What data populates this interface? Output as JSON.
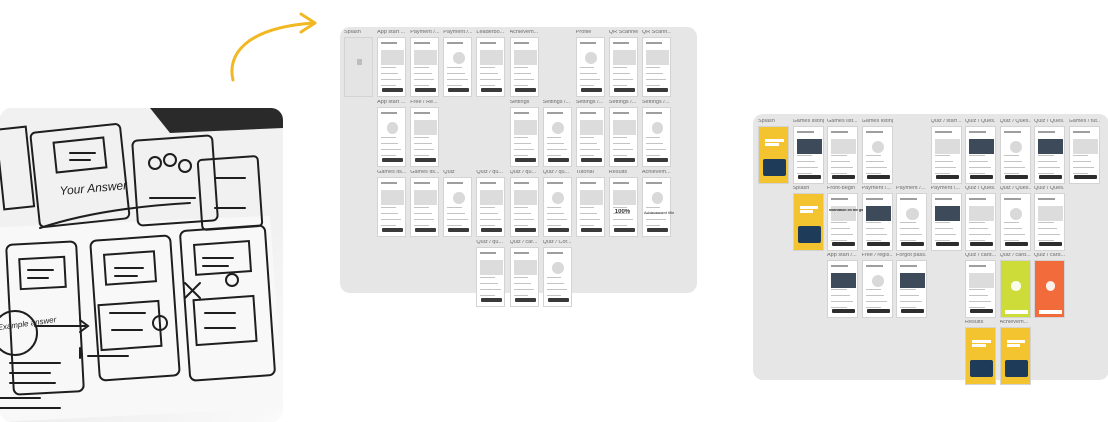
{
  "arrow": {
    "color": "#f2b824",
    "icon": "curved-arrow-icon"
  },
  "sketch": {
    "texts": [
      "Your Answer",
      "Example answer"
    ]
  },
  "wireframes": {
    "frames": [
      {
        "label": "Splash",
        "col": 0,
        "row": 0
      },
      {
        "label": "App start ...",
        "col": 1,
        "row": 0
      },
      {
        "label": "Payment /...",
        "col": 2,
        "row": 0
      },
      {
        "label": "Payment /...",
        "col": 3,
        "row": 0
      },
      {
        "label": "Leaderbo...",
        "col": 4,
        "row": 0
      },
      {
        "label": "Achievem...",
        "col": 5,
        "row": 0
      },
      {
        "label": "Profile",
        "col": 7,
        "row": 0
      },
      {
        "label": "QR Scanner",
        "col": 8,
        "row": 0
      },
      {
        "label": "QR Scann...",
        "col": 9,
        "row": 0
      },
      {
        "label": "App start ...",
        "col": 1,
        "row": 1
      },
      {
        "label": "Free / Re...",
        "col": 2,
        "row": 1
      },
      {
        "label": "Settings",
        "col": 5,
        "row": 1
      },
      {
        "label": "Settings /...",
        "col": 6,
        "row": 1
      },
      {
        "label": "Settings /...",
        "col": 7,
        "row": 1
      },
      {
        "label": "Settings /...",
        "col": 8,
        "row": 1
      },
      {
        "label": "Settings /...",
        "col": 9,
        "row": 1
      },
      {
        "label": "Games its...",
        "col": 1,
        "row": 2
      },
      {
        "label": "Games its...",
        "col": 2,
        "row": 2
      },
      {
        "label": "Quiz",
        "col": 3,
        "row": 2
      },
      {
        "label": "Quiz / qu...",
        "col": 4,
        "row": 2
      },
      {
        "label": "Quiz / qu...",
        "col": 5,
        "row": 2
      },
      {
        "label": "Quiz / qu...",
        "col": 6,
        "row": 2
      },
      {
        "label": "Tutorial",
        "col": 7,
        "row": 2
      },
      {
        "label": "Results",
        "col": 8,
        "row": 2
      },
      {
        "label": "Achievem...",
        "col": 9,
        "row": 2
      },
      {
        "label": "Quiz / qu...",
        "col": 4,
        "row": 3
      },
      {
        "label": "Quiz / car...",
        "col": 5,
        "row": 3
      },
      {
        "label": "Quiz / Cor...",
        "col": 6,
        "row": 3
      }
    ],
    "texts": {
      "result_percent": "100%",
      "achievement": "Achievement title"
    }
  },
  "hifi": {
    "frames": [
      {
        "label": "Splash",
        "col": 0,
        "row": 0,
        "theme": "yellow"
      },
      {
        "label": "Games listing",
        "col": 1,
        "row": 0,
        "theme": "white"
      },
      {
        "label": "Games list...",
        "col": 2,
        "row": 0,
        "theme": "white"
      },
      {
        "label": "Games listing",
        "col": 3,
        "row": 0,
        "theme": "white"
      },
      {
        "label": "Quiz / start ...",
        "col": 5,
        "row": 0,
        "theme": "white"
      },
      {
        "label": "Quiz / Ques...",
        "col": 6,
        "row": 0,
        "theme": "white"
      },
      {
        "label": "Quiz / Ques...",
        "col": 7,
        "row": 0,
        "theme": "white"
      },
      {
        "label": "Quiz / Ques...",
        "col": 8,
        "row": 0,
        "theme": "white"
      },
      {
        "label": "Games / tut...",
        "col": 9,
        "row": 0,
        "theme": "white"
      },
      {
        "label": "Splash",
        "col": 1,
        "row": 1,
        "theme": "yellow"
      },
      {
        "label": "Front-begin",
        "col": 2,
        "row": 1,
        "theme": "white"
      },
      {
        "label": "Payment /...",
        "col": 3,
        "row": 1,
        "theme": "white"
      },
      {
        "label": "Payment /...",
        "col": 4,
        "row": 1,
        "theme": "white"
      },
      {
        "label": "Payment /...",
        "col": 5,
        "row": 1,
        "theme": "white"
      },
      {
        "label": "Quiz / Ques...",
        "col": 6,
        "row": 1,
        "theme": "white"
      },
      {
        "label": "Quiz / Ques...",
        "col": 7,
        "row": 1,
        "theme": "white"
      },
      {
        "label": "Quiz / Ques...",
        "col": 8,
        "row": 1,
        "theme": "white"
      },
      {
        "label": "App start /...",
        "col": 2,
        "row": 2,
        "theme": "white"
      },
      {
        "label": "Free / regis...",
        "col": 3,
        "row": 2,
        "theme": "white"
      },
      {
        "label": "Forgot pass...",
        "col": 4,
        "row": 2,
        "theme": "white"
      },
      {
        "label": "Quiz / card...",
        "col": 6,
        "row": 2,
        "theme": "white"
      },
      {
        "label": "Quiz / card...",
        "col": 7,
        "row": 2,
        "theme": "lime"
      },
      {
        "label": "Quiz / card...",
        "col": 8,
        "row": 2,
        "theme": "orange"
      },
      {
        "label": "Results",
        "col": 6,
        "row": 3,
        "theme": "yellow"
      },
      {
        "label": "Achievem...",
        "col": 7,
        "row": 3,
        "theme": "yellow"
      }
    ],
    "texts": {
      "motivation": "Motivation on the go"
    }
  },
  "colors": {
    "board": "#e6e6e6",
    "yellow": "#f4c430",
    "lime": "#cddc39",
    "orange": "#f26b3a",
    "dark": "#2d2d2d"
  }
}
